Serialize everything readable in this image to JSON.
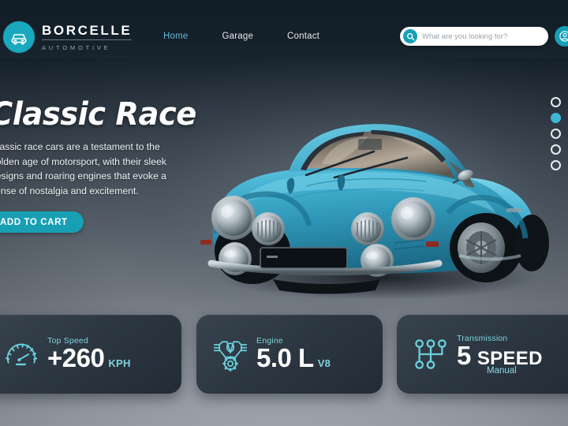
{
  "brand": {
    "name": "BORCELLE",
    "subtitle": "AUTOMOTIVE",
    "logo_icon": "car-icon",
    "accent_color": "#14a0b6"
  },
  "nav": {
    "items": [
      {
        "label": "Home",
        "active": true
      },
      {
        "label": "Garage",
        "active": false
      },
      {
        "label": "Contact",
        "active": false
      }
    ]
  },
  "search": {
    "placeholder": "What are you looking for?",
    "value": "",
    "icon": "search-icon"
  },
  "account": {
    "icon": "user-account-icon"
  },
  "hero": {
    "title": "Classic Race",
    "description": "Classic race cars are a testament to the golden age of motorsport, with their sleek designs and roaring engines that evoke a sense of nostalgia and excitement.",
    "cta_label": "ADD TO CART",
    "cta_color": "#189fb4",
    "image_alt": "classic-blue-sports-car"
  },
  "carousel": {
    "total": 5,
    "active_index": 1,
    "active_color": "#3fb6d6",
    "inactive_color": "#e8ecf0"
  },
  "stats": [
    {
      "icon": "speedometer-icon",
      "label": "Top Speed",
      "value": "+260",
      "unit": "KPH"
    },
    {
      "icon": "engine-icon",
      "label": "Engine",
      "value": "5.0 L",
      "unit": "V8"
    },
    {
      "icon": "gear-shifter-icon",
      "label": "Transmission",
      "value": "5",
      "unit": "SPEED",
      "sub": "Manual"
    }
  ],
  "theme": {
    "accent": "#14a0b6",
    "accent_light": "#7fd4dd",
    "nav_active": "#6bb8d6",
    "header_bg": "#121e28",
    "card_bg": "#2c3742",
    "car_body": "#3aa6c8"
  }
}
